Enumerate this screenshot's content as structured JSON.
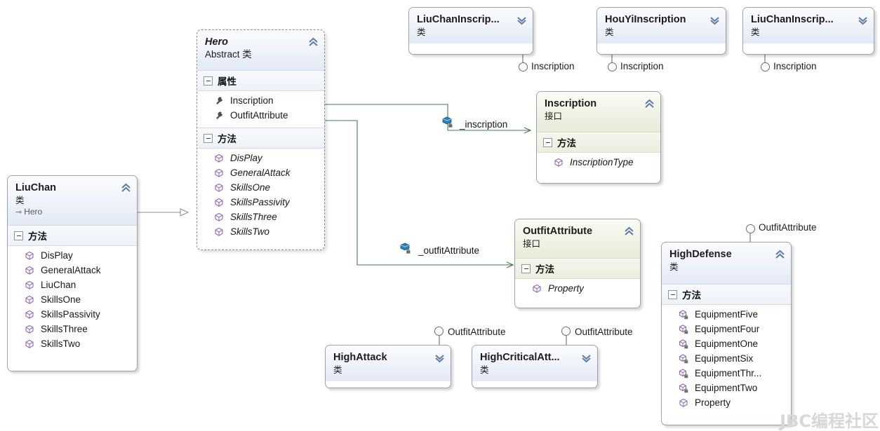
{
  "diagram": {
    "title": "UML Class Diagram",
    "watermark": "JBC编程社区",
    "colors": {
      "class_header_top": "#fbfcfe",
      "class_header_bottom": "#e3eaf6",
      "interface_header_top": "#fbfcf6",
      "interface_header_bottom": "#e6ecd8",
      "association_line": "#4a7a55",
      "inheritance_line": "#8c9298",
      "method_icon": "#8e63bf",
      "attribute_icon": "#4d4d4d",
      "watermark": "#d7d7d7"
    },
    "labels": {
      "section_attributes": "属性",
      "section_methods": "方法",
      "kind_class": "类",
      "kind_interface": "接口",
      "kind_abstract_class": "Abstract 类"
    }
  },
  "nodes": {
    "liuchan": {
      "name": "LiuChan",
      "kind": "类",
      "base": "Hero",
      "sections": [
        {
          "title": "方法",
          "members": [
            {
              "label": "DisPlay",
              "icon": "method-icon"
            },
            {
              "label": "GeneralAttack",
              "icon": "method-icon"
            },
            {
              "label": "LiuChan",
              "icon": "method-icon"
            },
            {
              "label": "SkillsOne",
              "icon": "method-icon"
            },
            {
              "label": "SkillsPassivity",
              "icon": "method-icon"
            },
            {
              "label": "SkillsThree",
              "icon": "method-icon"
            },
            {
              "label": "SkillsTwo",
              "icon": "method-icon"
            }
          ]
        }
      ]
    },
    "hero": {
      "name": "Hero",
      "kind": "Abstract 类",
      "sections": [
        {
          "title": "属性",
          "members": [
            {
              "label": "Inscription",
              "icon": "field-icon"
            },
            {
              "label": "OutfitAttribute",
              "icon": "field-icon"
            }
          ]
        },
        {
          "title": "方法",
          "members": [
            {
              "label": "DisPlay",
              "icon": "method-icon"
            },
            {
              "label": "GeneralAttack",
              "icon": "method-icon"
            },
            {
              "label": "SkillsOne",
              "icon": "method-icon"
            },
            {
              "label": "SkillsPassivity",
              "icon": "method-icon"
            },
            {
              "label": "SkillsThree",
              "icon": "method-icon"
            },
            {
              "label": "SkillsTwo",
              "icon": "method-icon"
            }
          ]
        }
      ]
    },
    "inscription_iface": {
      "name": "Inscription",
      "kind": "接口",
      "sections": [
        {
          "title": "方法",
          "members": [
            {
              "label": "InscriptionType",
              "icon": "method-icon"
            }
          ]
        }
      ]
    },
    "outfitattribute_iface": {
      "name": "OutfitAttribute",
      "kind": "接口",
      "sections": [
        {
          "title": "方法",
          "members": [
            {
              "label": "Property",
              "icon": "method-icon"
            }
          ]
        }
      ]
    },
    "highdefense": {
      "name": "HighDefense",
      "kind": "类",
      "sections": [
        {
          "title": "方法",
          "members": [
            {
              "label": "EquipmentFive",
              "icon": "method-locked-icon"
            },
            {
              "label": "EquipmentFour",
              "icon": "method-locked-icon"
            },
            {
              "label": "EquipmentOne",
              "icon": "method-locked-icon"
            },
            {
              "label": "EquipmentSix",
              "icon": "method-locked-icon"
            },
            {
              "label": "EquipmentThr...",
              "icon": "method-locked-icon"
            },
            {
              "label": "EquipmentTwo",
              "icon": "method-locked-icon"
            },
            {
              "label": "Property",
              "icon": "method-icon"
            }
          ]
        }
      ]
    },
    "liuchaninscription_a": {
      "name": "LiuChanInscrip...",
      "kind": "类"
    },
    "houyiinscription": {
      "name": "HouYiInscription",
      "kind": "类"
    },
    "liuchaninscription_b": {
      "name": "LiuChanInscrip...",
      "kind": "类"
    },
    "highattack": {
      "name": "HighAttack",
      "kind": "类"
    },
    "highcriticalattack": {
      "name": "HighCriticalAtt...",
      "kind": "类"
    }
  },
  "lollipops": [
    {
      "id": "lolli-inscription-a",
      "label": "Inscription"
    },
    {
      "id": "lolli-inscription-b",
      "label": "Inscription"
    },
    {
      "id": "lolli-inscription-c",
      "label": "Inscription"
    },
    {
      "id": "lolli-outfit-highdefense",
      "label": "OutfitAttribute"
    },
    {
      "id": "lolli-outfit-highattack",
      "label": "OutfitAttribute"
    },
    {
      "id": "lolli-outfit-highcritical",
      "label": "OutfitAttribute"
    }
  ],
  "associations": [
    {
      "id": "assoc-inscription",
      "label": "_inscription"
    },
    {
      "id": "assoc-outfitattribute",
      "label": "_outfitAttribute"
    }
  ]
}
